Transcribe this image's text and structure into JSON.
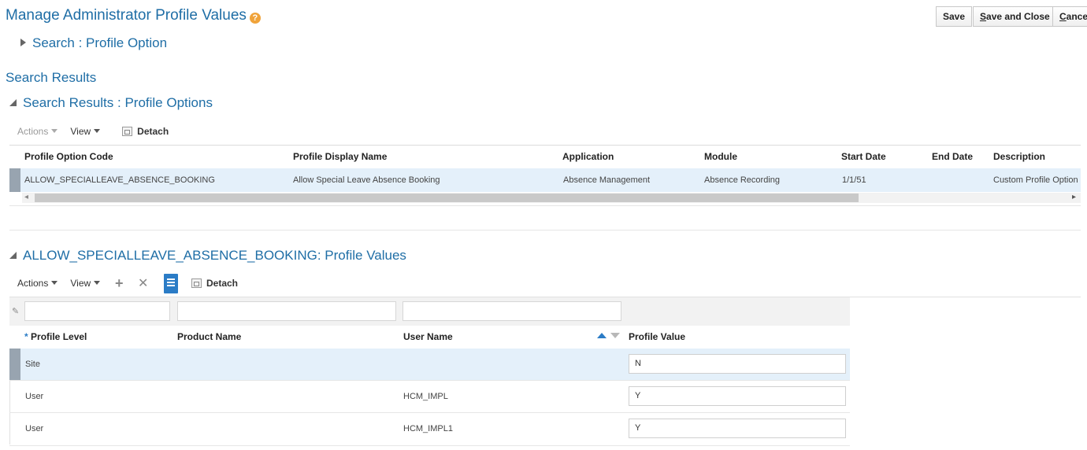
{
  "page": {
    "title": "Manage Administrator Profile Values",
    "help_icon": "?"
  },
  "buttons": {
    "save": "Save",
    "save_close": {
      "first": "S",
      "rest": "ave and Close"
    },
    "cancel": {
      "first": "C",
      "rest": "ancel"
    }
  },
  "search_section": {
    "label": "Search : Profile Option"
  },
  "results": {
    "heading": "Search Results",
    "panel_title": "Search Results : Profile Options",
    "toolbar": {
      "actions": "Actions",
      "view": "View",
      "detach": "Detach"
    },
    "columns": [
      "Profile Option Code",
      "Profile Display Name",
      "Application",
      "Module",
      "Start Date",
      "End Date",
      "Description"
    ],
    "rows": [
      [
        "ALLOW_SPECIALLEAVE_ABSENCE_BOOKING",
        "Allow Special Leave Absence Booking",
        "Absence Management",
        "Absence Recording",
        "1/1/51",
        "",
        "Custom Profile Option"
      ]
    ],
    "scroll_left": "◂",
    "scroll_right": "▸"
  },
  "values": {
    "panel_title": "ALLOW_SPECIALLEAVE_ABSENCE_BOOKING: Profile Values",
    "toolbar": {
      "actions": "Actions",
      "view": "View",
      "detach": "Detach",
      "add_icon": "+",
      "delete_icon": "✕"
    },
    "required_marker": "*",
    "columns": [
      "Profile Level",
      "Product Name",
      "User Name",
      "Profile Value"
    ],
    "rows": [
      {
        "level": "Site",
        "product": "",
        "user": "",
        "value": "N"
      },
      {
        "level": "User",
        "product": "",
        "user": "HCM_IMPL",
        "value": "Y"
      },
      {
        "level": "User",
        "product": "",
        "user": "HCM_IMPL1",
        "value": "Y"
      }
    ],
    "filter_icon": "✎"
  },
  "icons": {
    "help": "help-icon",
    "expand": "triangle-right-icon",
    "collapse": "triangle-down-icon",
    "detach": "detach-icon",
    "add": "plus-icon",
    "delete": "x-icon",
    "query_by_example": "filter-icon",
    "sort": "sort-icon"
  },
  "colors": {
    "link_blue": "#1f6ea6",
    "selected_row": "#e4f0fa",
    "accent": "#2b7cc6",
    "help_orange": "#f0a33a"
  }
}
